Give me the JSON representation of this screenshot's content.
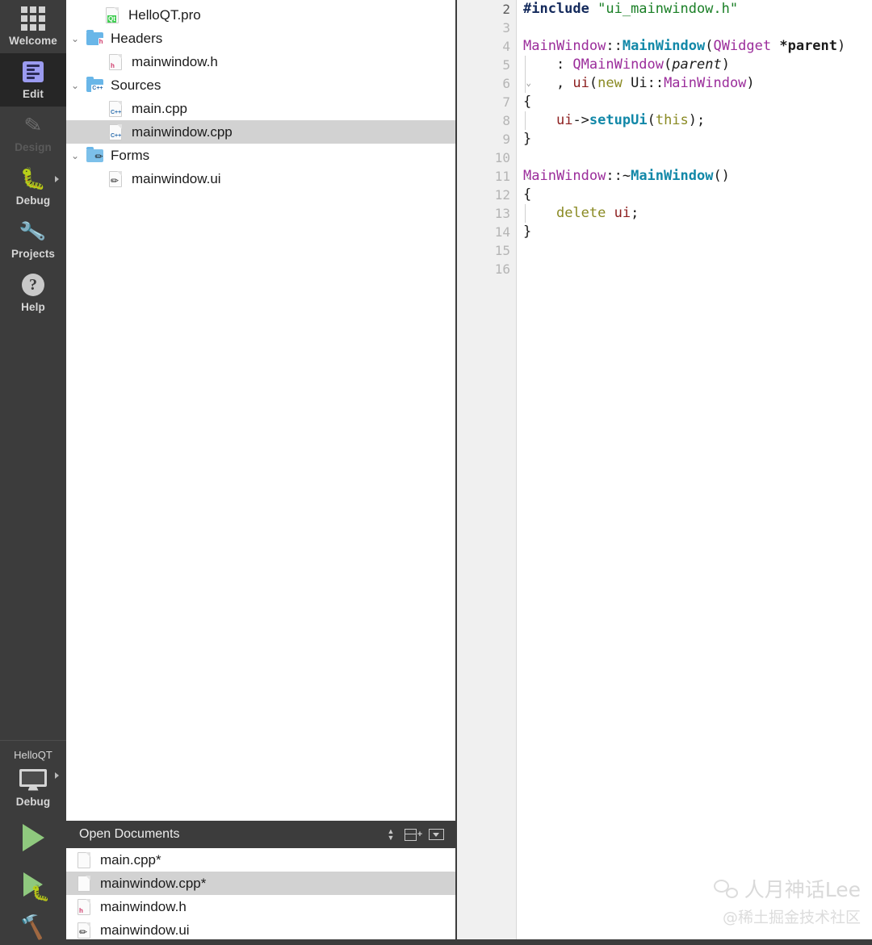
{
  "modebar": {
    "items": [
      {
        "label": "Welcome",
        "icon": "grid-icon",
        "state": "normal"
      },
      {
        "label": "Edit",
        "icon": "edit-icon",
        "state": "active"
      },
      {
        "label": "Design",
        "icon": "pencil-icon",
        "state": "disabled"
      },
      {
        "label": "Debug",
        "icon": "bug-icon",
        "state": "normal",
        "arrow": "▸"
      },
      {
        "label": "Projects",
        "icon": "wrench-icon",
        "state": "normal"
      },
      {
        "label": "Help",
        "icon": "question-mark-icon",
        "state": "normal"
      }
    ],
    "kit": {
      "project_name": "HelloQT",
      "build_config": "Debug",
      "monitor_icon": "monitor-icon",
      "arrow": "▸"
    },
    "actions": [
      {
        "name": "run-button",
        "icon": "play-icon"
      },
      {
        "name": "debug-button",
        "icon": "play-bug-icon"
      },
      {
        "name": "build-button",
        "icon": "hammer-icon"
      }
    ]
  },
  "project_tree": {
    "rows": [
      {
        "label": "HelloQT.pro",
        "indent": 1,
        "chevron": "",
        "icon": "qt-project-file-icon",
        "selected": false
      },
      {
        "label": "Headers",
        "indent": 0,
        "chevron": "⌄",
        "icon": "headers-folder-icon",
        "selected": false
      },
      {
        "label": "mainwindow.h",
        "indent": 2,
        "chevron": "",
        "icon": "header-file-icon",
        "selected": false
      },
      {
        "label": "Sources",
        "indent": 0,
        "chevron": "⌄",
        "icon": "sources-folder-icon",
        "selected": false
      },
      {
        "label": "main.cpp",
        "indent": 2,
        "chevron": "",
        "icon": "cpp-file-icon",
        "selected": false
      },
      {
        "label": "mainwindow.cpp",
        "indent": 2,
        "chevron": "",
        "icon": "cpp-file-icon",
        "selected": true
      },
      {
        "label": "Forms",
        "indent": 0,
        "chevron": "⌄",
        "icon": "forms-folder-icon",
        "selected": false
      },
      {
        "label": "mainwindow.ui",
        "indent": 2,
        "chevron": "",
        "icon": "ui-file-icon",
        "selected": false
      }
    ]
  },
  "open_documents": {
    "title": "Open Documents",
    "toolbar": [
      {
        "name": "sort-toggle-button",
        "icon": "sort-arrows-icon"
      },
      {
        "name": "split-editor-button",
        "icon": "split-plus-icon"
      },
      {
        "name": "editor-options-button",
        "icon": "dropdown-box-icon"
      }
    ],
    "rows": [
      {
        "label": "main.cpp*",
        "icon": "plain-file-icon",
        "selected": false
      },
      {
        "label": "mainwindow.cpp*",
        "icon": "plain-file-icon",
        "selected": true
      },
      {
        "label": "mainwindow.h",
        "icon": "header-file-icon",
        "selected": false
      },
      {
        "label": "mainwindow.ui",
        "icon": "ui-file-icon",
        "selected": false
      }
    ]
  },
  "editor": {
    "filename": "mainwindow.cpp",
    "first_visible_line": 2,
    "current_line": 2,
    "fold_marker_lines": [
      6,
      11
    ],
    "lines": [
      {
        "n": 2,
        "indent_guides": 0,
        "tokens": [
          {
            "t": "#include ",
            "c": "pre"
          },
          {
            "t": "\"ui_mainwindow.h\"",
            "c": "str"
          }
        ]
      },
      {
        "n": 3,
        "indent_guides": 0,
        "tokens": []
      },
      {
        "n": 4,
        "indent_guides": 0,
        "tokens": [
          {
            "t": "MainWindow",
            "c": "type"
          },
          {
            "t": "::",
            "c": "plain"
          },
          {
            "t": "MainWindow",
            "c": "fn"
          },
          {
            "t": "(",
            "c": "plain"
          },
          {
            "t": "QWidget",
            "c": "type"
          },
          {
            "t": " ",
            "c": "plain"
          },
          {
            "t": "*parent",
            "c": "bold"
          },
          {
            "t": ")",
            "c": "plain"
          }
        ]
      },
      {
        "n": 5,
        "indent_guides": 1,
        "tokens": [
          {
            "t": "    : ",
            "c": "plain"
          },
          {
            "t": "QMainWindow",
            "c": "type"
          },
          {
            "t": "(",
            "c": "plain"
          },
          {
            "t": "parent",
            "c": "param"
          },
          {
            "t": ")",
            "c": "plain"
          }
        ]
      },
      {
        "n": 6,
        "indent_guides": 1,
        "tokens": [
          {
            "t": "    , ",
            "c": "plain"
          },
          {
            "t": "ui",
            "c": "var"
          },
          {
            "t": "(",
            "c": "plain"
          },
          {
            "t": "new",
            "c": "kw"
          },
          {
            "t": " Ui::",
            "c": "plain"
          },
          {
            "t": "MainWindow",
            "c": "type"
          },
          {
            "t": ")",
            "c": "plain"
          }
        ]
      },
      {
        "n": 7,
        "indent_guides": 0,
        "tokens": [
          {
            "t": "{",
            "c": "plain"
          }
        ]
      },
      {
        "n": 8,
        "indent_guides": 1,
        "tokens": [
          {
            "t": "    ",
            "c": "plain"
          },
          {
            "t": "ui",
            "c": "var"
          },
          {
            "t": "->",
            "c": "plain"
          },
          {
            "t": "setupUi",
            "c": "fn"
          },
          {
            "t": "(",
            "c": "plain"
          },
          {
            "t": "this",
            "c": "kw"
          },
          {
            "t": ");",
            "c": "plain"
          }
        ]
      },
      {
        "n": 9,
        "indent_guides": 0,
        "tokens": [
          {
            "t": "}",
            "c": "plain"
          }
        ]
      },
      {
        "n": 10,
        "indent_guides": 0,
        "tokens": []
      },
      {
        "n": 11,
        "indent_guides": 0,
        "tokens": [
          {
            "t": "MainWindow",
            "c": "type"
          },
          {
            "t": "::~",
            "c": "plain"
          },
          {
            "t": "MainWindow",
            "c": "fn"
          },
          {
            "t": "()",
            "c": "plain"
          }
        ]
      },
      {
        "n": 12,
        "indent_guides": 0,
        "tokens": [
          {
            "t": "{",
            "c": "plain"
          }
        ]
      },
      {
        "n": 13,
        "indent_guides": 1,
        "tokens": [
          {
            "t": "    ",
            "c": "plain"
          },
          {
            "t": "delete",
            "c": "kw"
          },
          {
            "t": " ",
            "c": "plain"
          },
          {
            "t": "ui",
            "c": "var"
          },
          {
            "t": ";",
            "c": "plain"
          }
        ]
      },
      {
        "n": 14,
        "indent_guides": 0,
        "tokens": [
          {
            "t": "}",
            "c": "plain"
          }
        ]
      },
      {
        "n": 15,
        "indent_guides": 0,
        "tokens": []
      },
      {
        "n": 16,
        "indent_guides": 0,
        "tokens": []
      }
    ]
  },
  "watermark": {
    "line1": "人月神话Lee",
    "line2": "@稀土掘金技术社区",
    "icon": "wechat-icon"
  },
  "colors": {
    "modebar_bg": "#3c3c3c",
    "modebar_active_bg": "#262626",
    "selection_bg": "#d2d2d2",
    "gutter_bg": "#f0f0f0",
    "accent_green": "#8fc97e",
    "folder_blue": "#69b6e8",
    "keyword": "#8a8a23",
    "type": "#9b2d9b",
    "function": "#1288a8",
    "string": "#1a7f26",
    "variable": "#8d2020",
    "preprocessor": "#142a5c"
  }
}
